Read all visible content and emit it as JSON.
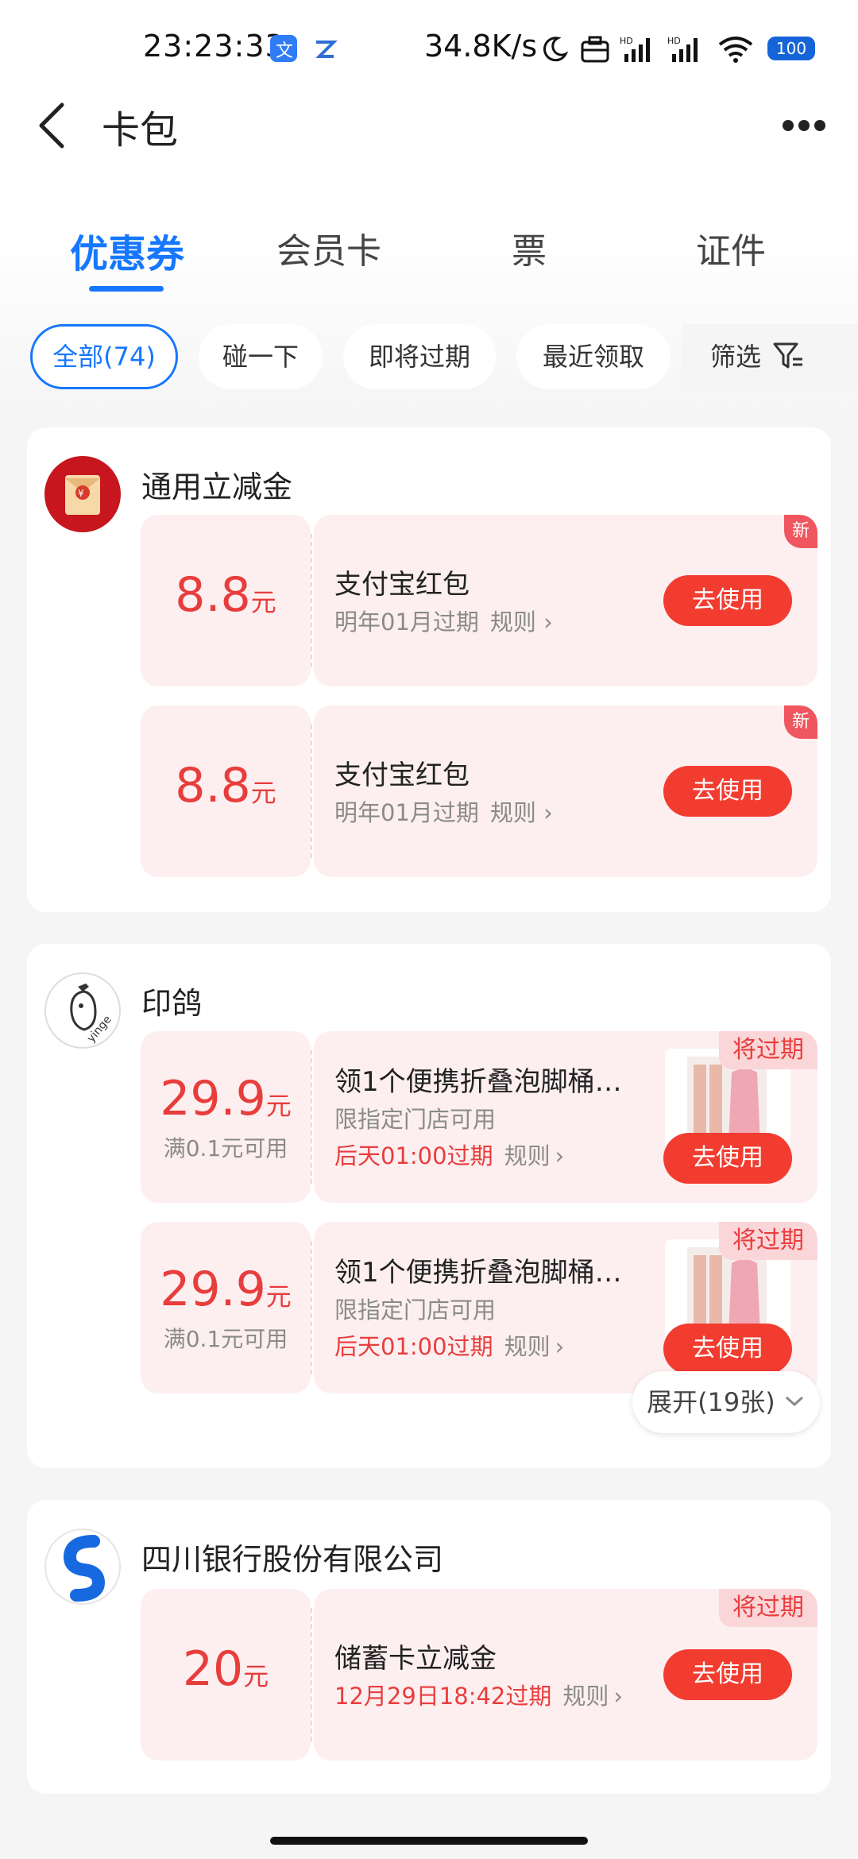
{
  "status_bar": {
    "time": "23:23:33",
    "speed": "34.8K/s",
    "battery": "100",
    "icons": [
      "translate-app-icon",
      "app-notification-icon",
      "moon-icon",
      "briefcase-icon",
      "signal-hd-icon",
      "signal-hd-icon",
      "wifi-icon",
      "battery-icon"
    ]
  },
  "header": {
    "title": "卡包",
    "back_icon": "chevron-left-icon",
    "more_icon": "more-dots-icon"
  },
  "tabs": [
    {
      "label": "优惠券",
      "active": true
    },
    {
      "label": "会员卡"
    },
    {
      "label": "票"
    },
    {
      "label": "证件"
    }
  ],
  "chips": [
    {
      "label": "全部(74)",
      "active": true
    },
    {
      "label": "碰一下"
    },
    {
      "label": "即将过期"
    },
    {
      "label": "最近领取"
    }
  ],
  "filter": {
    "label": "筛选",
    "icon": "filter-icon"
  },
  "cards": [
    {
      "merchant": "通用立减金",
      "logo": "red-envelope-icon",
      "coupons": [
        {
          "amount": "8.8",
          "unit": "元",
          "name": "支付宝红包",
          "expire": "明年01月过期",
          "rule": "规则",
          "tag": "新",
          "button": "去使用"
        },
        {
          "amount": "8.8",
          "unit": "元",
          "name": "支付宝红包",
          "expire": "明年01月过期",
          "rule": "规则",
          "tag": "新",
          "button": "去使用"
        }
      ]
    },
    {
      "merchant": "印鸽",
      "logo": "yinge-logo",
      "coupons": [
        {
          "amount": "29.9",
          "unit": "元",
          "condition": "满0.1元可用",
          "name": "领1个便携折叠泡脚桶…",
          "sub": "限指定门店可用",
          "expire": "后天01:00过期",
          "rule": "规则",
          "tag": "将过期",
          "button": "去使用"
        },
        {
          "amount": "29.9",
          "unit": "元",
          "condition": "满0.1元可用",
          "name": "领1个便携折叠泡脚桶…",
          "sub": "限指定门店可用",
          "expire": "后天01:00过期",
          "rule": "规则",
          "tag": "将过期",
          "button": "去使用"
        }
      ],
      "expand": "展开(19张)"
    },
    {
      "merchant": "四川银行股份有限公司",
      "logo": "sichuan-bank-logo",
      "coupons": [
        {
          "amount": "20",
          "unit": "元",
          "name": "储蓄卡立减金",
          "expire": "12月29日18:42过期",
          "rule": "规则",
          "tag": "将过期",
          "button": "去使用"
        }
      ]
    }
  ],
  "colors": {
    "accent": "#1677ff",
    "red": "#e83d3d",
    "button": "#f23c30",
    "coupon_bg": "#fdeff0"
  }
}
